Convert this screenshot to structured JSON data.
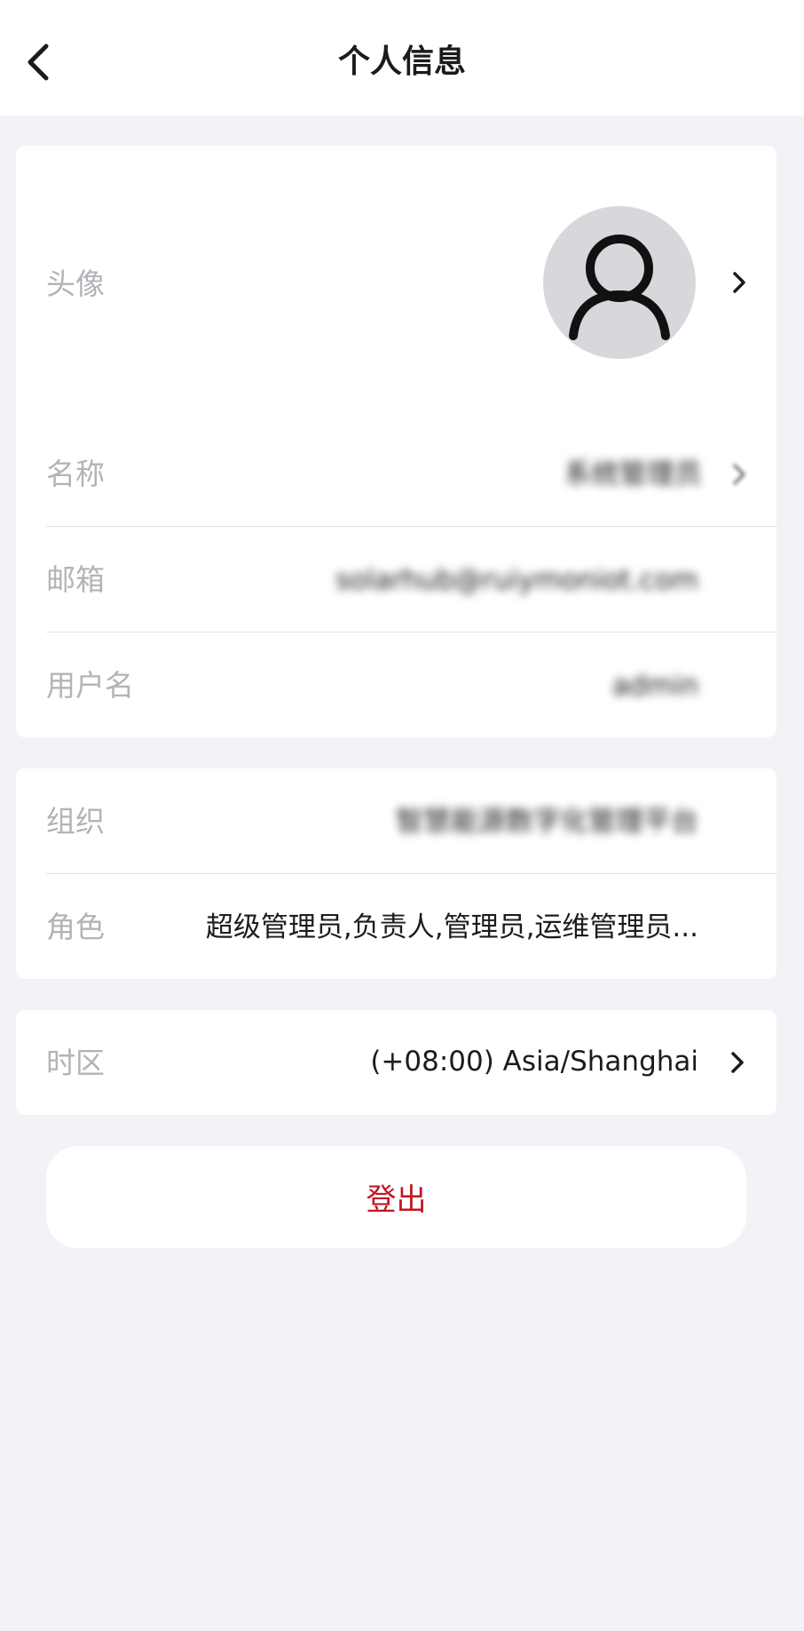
{
  "header": {
    "title": "个人信息"
  },
  "profile": {
    "avatar_label": "头像",
    "name_label": "名称",
    "name_value": "系统管理员",
    "email_label": "邮箱",
    "email_value": "solarhub@ruiymoniot.com",
    "username_label": "用户名",
    "username_value": "admin"
  },
  "organization": {
    "org_label": "组织",
    "org_value": "智慧能源数字化管理平台",
    "role_label": "角色",
    "role_value": "超级管理员,负责人,管理员,运维管理员..."
  },
  "timezone": {
    "label": "时区",
    "value": "(+08:00) Asia/Shanghai"
  },
  "actions": {
    "logout_label": "登出"
  },
  "colors": {
    "accent_logout": "#c41522",
    "background": "#f3f2f6",
    "label_gray": "#b3b3b8"
  }
}
